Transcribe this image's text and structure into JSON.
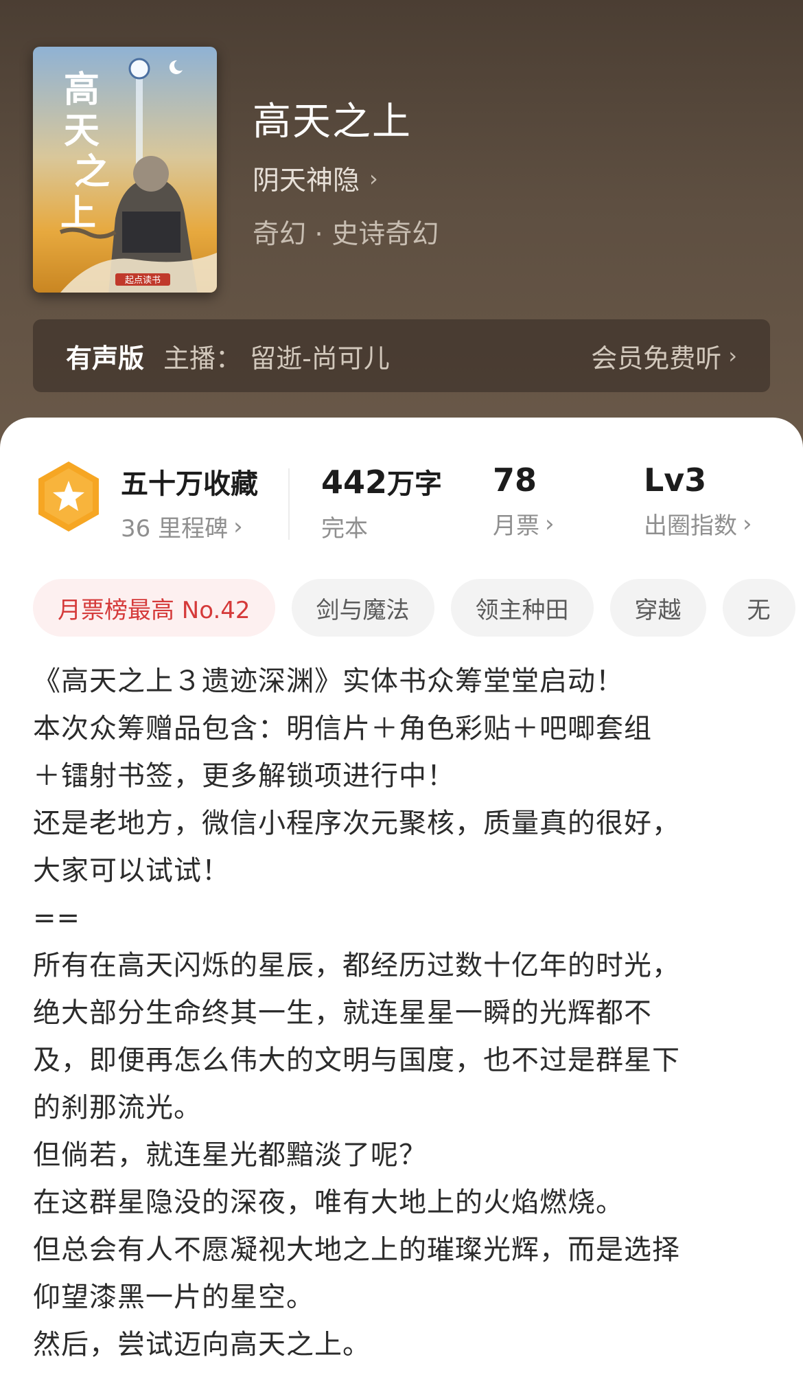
{
  "book": {
    "title": "高天之上",
    "author": "阴天神隐",
    "genre": "奇幻 · 史诗奇幻",
    "cover": {
      "title_text": "高天之上",
      "author_text": "阴天神隐",
      "publisher_text": "起点读书"
    }
  },
  "audio": {
    "tag": "有声版",
    "host": "主播：  留逝-尚可儿",
    "action": "会员免费听"
  },
  "stats": {
    "favorites": {
      "main": "五十万收藏",
      "sub": "36 里程碑"
    },
    "words": {
      "number": "442",
      "unit": "万字",
      "sub": "完本"
    },
    "tickets": {
      "main": "78",
      "sub": "月票"
    },
    "level": {
      "main": "Lv3",
      "sub": "出圈指数"
    }
  },
  "tags": [
    "月票榜最高 No.42",
    "剑与魔法",
    "领主种田",
    "穿越",
    "无"
  ],
  "description": [
    "《高天之上３遗迹深渊》实体书众筹堂堂启动！",
    "本次众筹赠品包含：明信片＋角色彩贴＋吧唧套组",
    "＋镭射书签，更多解锁项进行中！",
    "还是老地方，微信小程序次元聚核，质量真的很好，",
    "大家可以试试！",
    "==",
    "所有在高天闪烁的星辰，都经历过数十亿年的时光，",
    "绝大部分生命终其一生，就连星星一瞬的光辉都不",
    "及，即便再怎么伟大的文明与国度，也不过是群星下",
    "的刹那流光。",
    "但倘若，就连星光都黯淡了呢？",
    "在这群星隐没的深夜，唯有大地上的火焰燃烧。",
    "但总会有人不愿凝视大地之上的璀璨光辉，而是选择",
    "仰望漆黑一片的星空。",
    "然后，尝试迈向高天之上。"
  ],
  "colors": {
    "hero_bg": "#5e4f41",
    "hot_tag_text": "#d53a3a",
    "medal_orange": "#f6a623"
  }
}
